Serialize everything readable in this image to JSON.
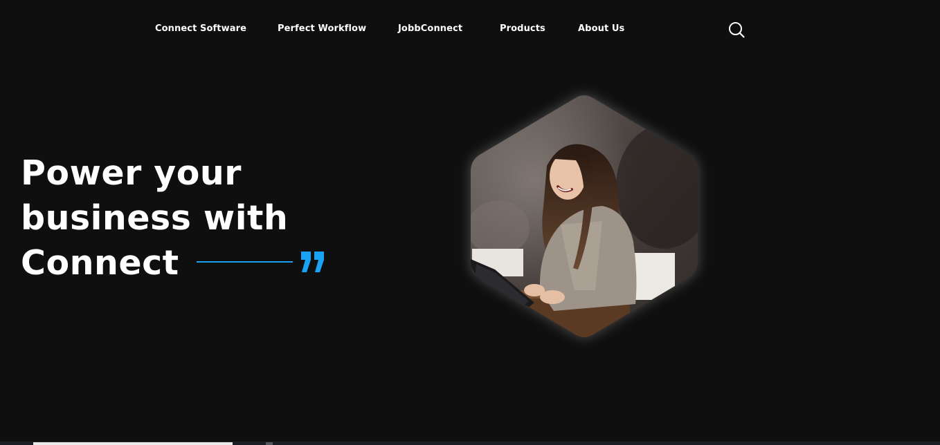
{
  "nav": {
    "items": [
      {
        "label": "Connect Software"
      },
      {
        "label": "Perfect Workflow"
      },
      {
        "label": "JobbConnect"
      },
      {
        "label": "Products"
      },
      {
        "label": "About Us"
      }
    ],
    "search_icon": "search-icon"
  },
  "hero": {
    "title_lines": [
      "Power your",
      "business with",
      "Connect"
    ],
    "quote_icon": "quote-icon",
    "image_icon": "photo-woman-laughing-with-notebook"
  },
  "colors": {
    "background": "#0f0f10",
    "text": "#ffffff",
    "accent": "#1aa3f5"
  }
}
